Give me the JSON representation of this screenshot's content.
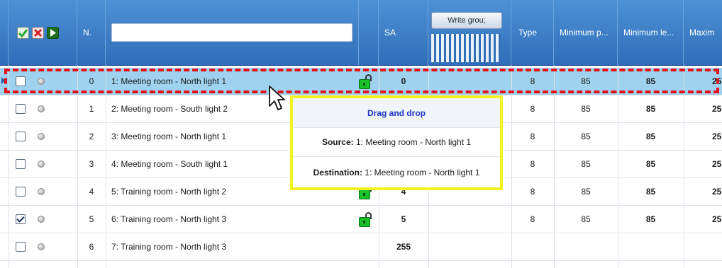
{
  "header": {
    "n_label": "N.",
    "search_value": "",
    "sa_label": "SA",
    "write_group_label": "Write grou;",
    "type_label": "Type",
    "min_p_label": "Minimum p...",
    "min_le_label": "Minimum le...",
    "max_label": "Maxim"
  },
  "rows": [
    {
      "checked": false,
      "n": "0",
      "name": "1: Meeting room - North light 1",
      "sa": "0",
      "type": "8",
      "min_p": "85",
      "min_le": "85",
      "max": "25",
      "lock": "open"
    },
    {
      "checked": false,
      "n": "1",
      "name": "2: Meeting room - South light  2",
      "sa": "",
      "type": "8",
      "min_p": "85",
      "min_le": "85",
      "max": "25",
      "lock": ""
    },
    {
      "checked": false,
      "n": "2",
      "name": "3: Meeting room - North light  1",
      "sa": "",
      "type": "8",
      "min_p": "85",
      "min_le": "85",
      "max": "25",
      "lock": ""
    },
    {
      "checked": false,
      "n": "3",
      "name": "4: Meeting room - South light 1",
      "sa": "",
      "type": "8",
      "min_p": "85",
      "min_le": "85",
      "max": "25",
      "lock": ""
    },
    {
      "checked": false,
      "n": "4",
      "name": "5: Training room - North light 2",
      "sa": "4",
      "type": "8",
      "min_p": "85",
      "min_le": "85",
      "max": "25",
      "lock": "open"
    },
    {
      "checked": true,
      "n": "5",
      "name": "6: Training room - North light 3",
      "sa": "5",
      "type": "8",
      "min_p": "85",
      "min_le": "85",
      "max": "25",
      "lock": "open"
    },
    {
      "checked": false,
      "n": "6",
      "name": "7: Training room - North light 3",
      "sa": "255",
      "type": "",
      "min_p": "",
      "min_le": "",
      "max": "",
      "lock": ""
    }
  ],
  "tooltip": {
    "title": "Drag and drop",
    "source_label": "Source:",
    "source_value": " 1: Meeting room - North light 1",
    "destination_label": "Destination:",
    "destination_value": " 1: Meeting room - North light 1"
  },
  "colors": {
    "header": "#3a7ec8",
    "selected_row": "#9fd2ee",
    "highlight_dash": "#e3121a",
    "tooltip_border": "#f2f221",
    "lock": "#18c12a"
  },
  "icons": {
    "check_all": "check-all-icon",
    "delete": "delete-icon",
    "run": "play-icon",
    "cursor": "arrow-cursor-icon"
  }
}
